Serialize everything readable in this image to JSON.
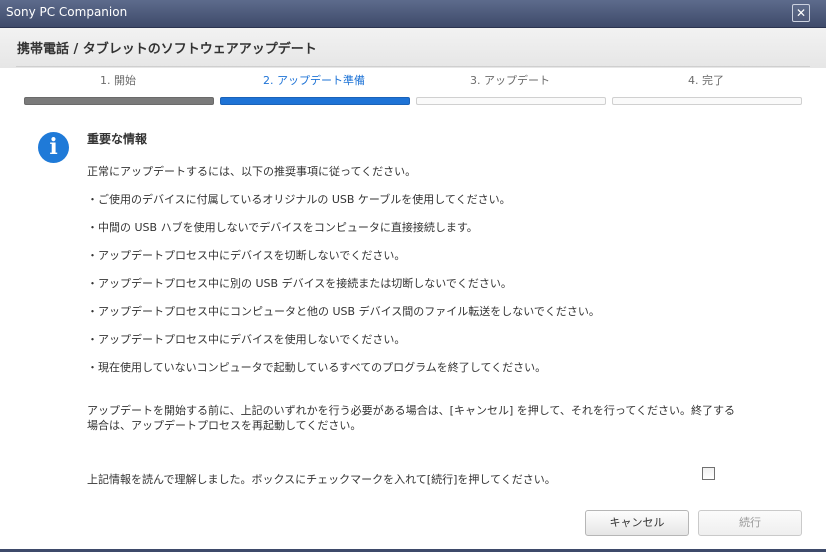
{
  "window": {
    "title": "Sony PC Companion",
    "close_glyph": "✕"
  },
  "header": {
    "title": "携帯電話 / タブレットのソフトウェアアップデート"
  },
  "steps": [
    {
      "label": "1. 開始",
      "state": "done"
    },
    {
      "label": "2. アップデート準備",
      "state": "active"
    },
    {
      "label": "3. アップデート",
      "state": "pending"
    },
    {
      "label": "4. 完了",
      "state": "pending"
    }
  ],
  "info": {
    "icon": "info-icon",
    "icon_glyph": "i",
    "heading": "重要な情報",
    "intro": "正常にアップデートするには、以下の推奨事項に従ってください。",
    "bullets": [
      "・ご使用のデバイスに付属しているオリジナルの USB ケーブルを使用してください。",
      "・中間の USB ハブを使用しないでデバイスをコンピュータに直接接続します。",
      "・アップデートプロセス中にデバイスを切断しないでください。",
      "・アップデートプロセス中に別の USB デバイスを接続または切断しないでください。",
      "・アップデートプロセス中にコンピュータと他の USB デバイス間のファイル転送をしないでください。",
      "・アップデートプロセス中にデバイスを使用しないでください。",
      "・現在使用していないコンピュータで起動しているすべてのプログラムを終了してください。"
    ],
    "closing": "アップデートを開始する前に、上記のいずれかを行う必要がある場合は、[キャンセル] を押して、それを行ってください。終了する場合は、アップデートプロセスを再起動してください。"
  },
  "agreement": {
    "label": "上記情報を読んで理解しました。ボックスにチェックマークを入れて[続行]を押してください。",
    "checked": false
  },
  "buttons": {
    "cancel": "キャンセル",
    "next": "続行",
    "next_enabled": false
  },
  "colors": {
    "accent": "#1e73d6",
    "titlebar": "#4a5678",
    "done_bar": "#7a7a7a"
  }
}
